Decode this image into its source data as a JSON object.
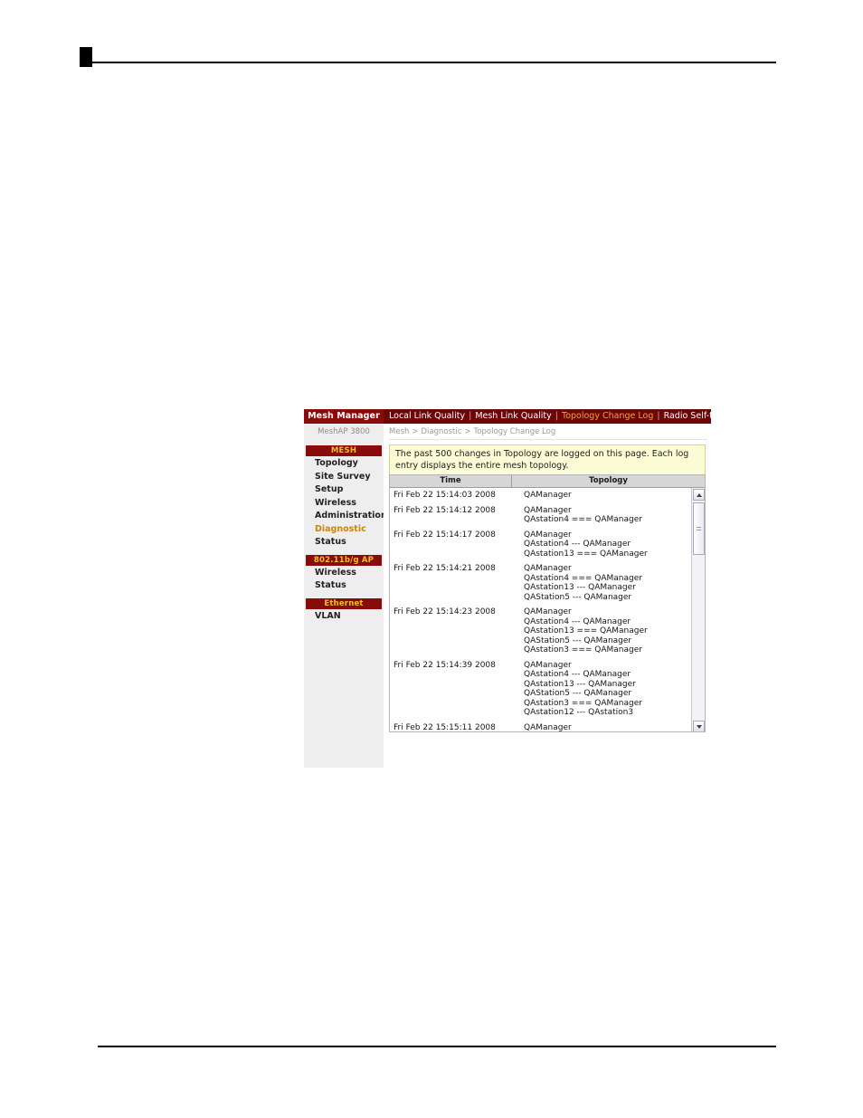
{
  "ui": {
    "brand": "Mesh Manager",
    "model": "MeshAP 3800",
    "top_nav": [
      {
        "label": "Local Link Quality",
        "active": false
      },
      {
        "label": "Mesh Link Quality",
        "active": false
      },
      {
        "label": "Topology Change Log",
        "active": true
      },
      {
        "label": "Radio Self-test",
        "active": false
      }
    ],
    "breadcrumb": [
      "Mesh",
      "Diagnostic",
      "Topology Change Log"
    ],
    "breadcrumb_separator": ">",
    "info_text": "The past 500 changes in Topology are logged on this page. Each log entry displays the entire mesh topology.",
    "sidebar": [
      {
        "section": "MESH",
        "items": [
          {
            "label": "Topology",
            "active": false
          },
          {
            "label": "Site Survey",
            "active": false
          },
          {
            "label": "Setup",
            "active": false
          },
          {
            "label": "Wireless",
            "active": false
          },
          {
            "label": "Administration",
            "active": false
          },
          {
            "label": "Diagnostic",
            "active": true
          },
          {
            "label": "Status",
            "active": false
          }
        ]
      },
      {
        "section": "802.11b/g AP",
        "items": [
          {
            "label": "Wireless",
            "active": false
          },
          {
            "label": "Status",
            "active": false
          }
        ]
      },
      {
        "section": "Ethernet",
        "items": [
          {
            "label": "VLAN",
            "active": false
          }
        ]
      }
    ],
    "table": {
      "columns": [
        "Time",
        "Topology"
      ],
      "rows": [
        {
          "time": "Fri Feb 22 15:14:03 2008",
          "topology": "QAManager"
        },
        {
          "time": "Fri Feb 22 15:14:12 2008",
          "topology": "QAManager\nQAstation4 === QAManager"
        },
        {
          "time": "Fri Feb 22 15:14:17 2008",
          "topology": "QAManager\nQAstation4 --- QAManager\nQAstation13 === QAManager"
        },
        {
          "time": "Fri Feb 22 15:14:21 2008",
          "topology": "QAManager\nQAstation4 === QAManager\nQAstation13 --- QAManager\nQAStation5 --- QAManager"
        },
        {
          "time": "Fri Feb 22 15:14:23 2008",
          "topology": "QAManager\nQAstation4 --- QAManager\nQAstation13 === QAManager\nQAStation5 --- QAManager\nQAstation3 === QAManager"
        },
        {
          "time": "Fri Feb 22 15:14:39 2008",
          "topology": "QAManager\nQAstation4 --- QAManager\nQAstation13 --- QAManager\nQAStation5 --- QAManager\nQAstation3 === QAManager\nQAstation12 --- QAstation3"
        },
        {
          "time": "Fri Feb 22 15:15:11 2008",
          "topology": "QAManager"
        }
      ]
    },
    "scrollbar": {
      "up_icon": "scroll-up-arrow-icon",
      "down_icon": "scroll-down-arrow-icon"
    }
  },
  "colors": {
    "brand_dark_red": "#8a0b0b",
    "nav_dark_red": "#6d0606",
    "accent_gold": "#f0a81e",
    "section_gold": "#f0c020",
    "active_item": "#c8860d",
    "info_yellow": "#fbfbd6",
    "sidebar_gray": "#eeeeee"
  }
}
